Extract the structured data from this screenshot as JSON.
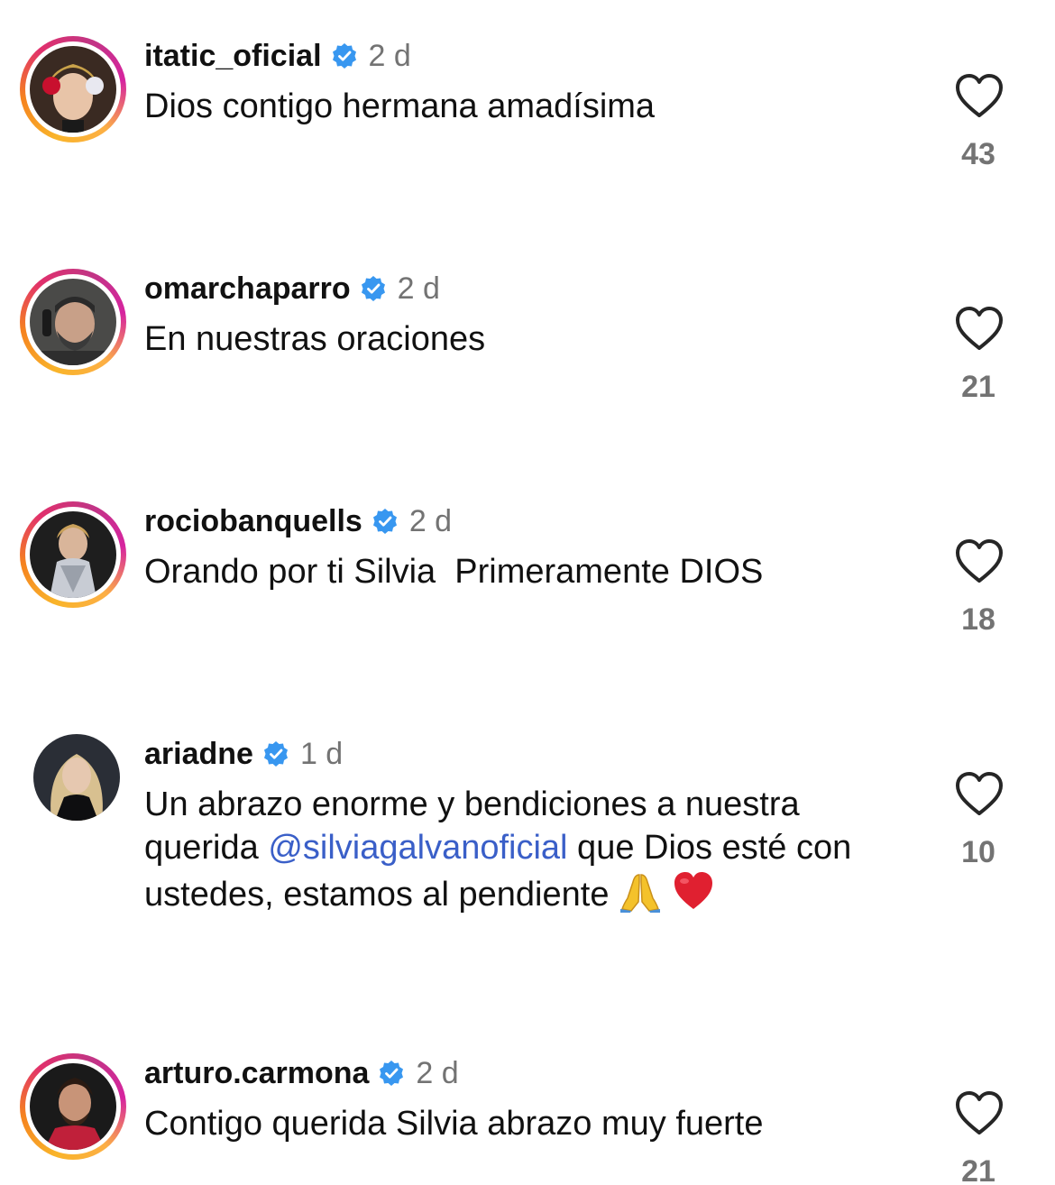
{
  "comments": [
    {
      "username": "itatic_oficial",
      "time": "2 d",
      "text": "Dios contigo hermana amadísima",
      "likes": "43",
      "has_story_ring": true,
      "verified": true
    },
    {
      "username": "omarchaparro",
      "time": "2 d",
      "text": "En nuestras oraciones",
      "likes": "21",
      "has_story_ring": true,
      "verified": true
    },
    {
      "username": "rociobanquells",
      "time": "2 d",
      "text": "Orando por ti Silvia  Primeramente DIOS",
      "likes": "18",
      "has_story_ring": true,
      "verified": true
    },
    {
      "username": "ariadne",
      "time": "1 d",
      "text_before": "Un abrazo enorme y bendiciones a nuestra querida ",
      "mention": "@silviagalvanoficial",
      "text_after": " que Dios esté con ustedes, estamos al pendiente",
      "emojis": [
        "folded-hands-emoji",
        "red-heart-emoji"
      ],
      "likes": "10",
      "has_story_ring": false,
      "verified": true
    },
    {
      "username": "arturo.carmona",
      "time": "2 d",
      "text": "Contigo querida Silvia abrazo muy fuerte",
      "likes": "21",
      "has_story_ring": true,
      "verified": true
    }
  ],
  "colors": {
    "verified_badge": "#3897f0",
    "mention": "#3a5fc8",
    "muted_text": "#737373"
  }
}
